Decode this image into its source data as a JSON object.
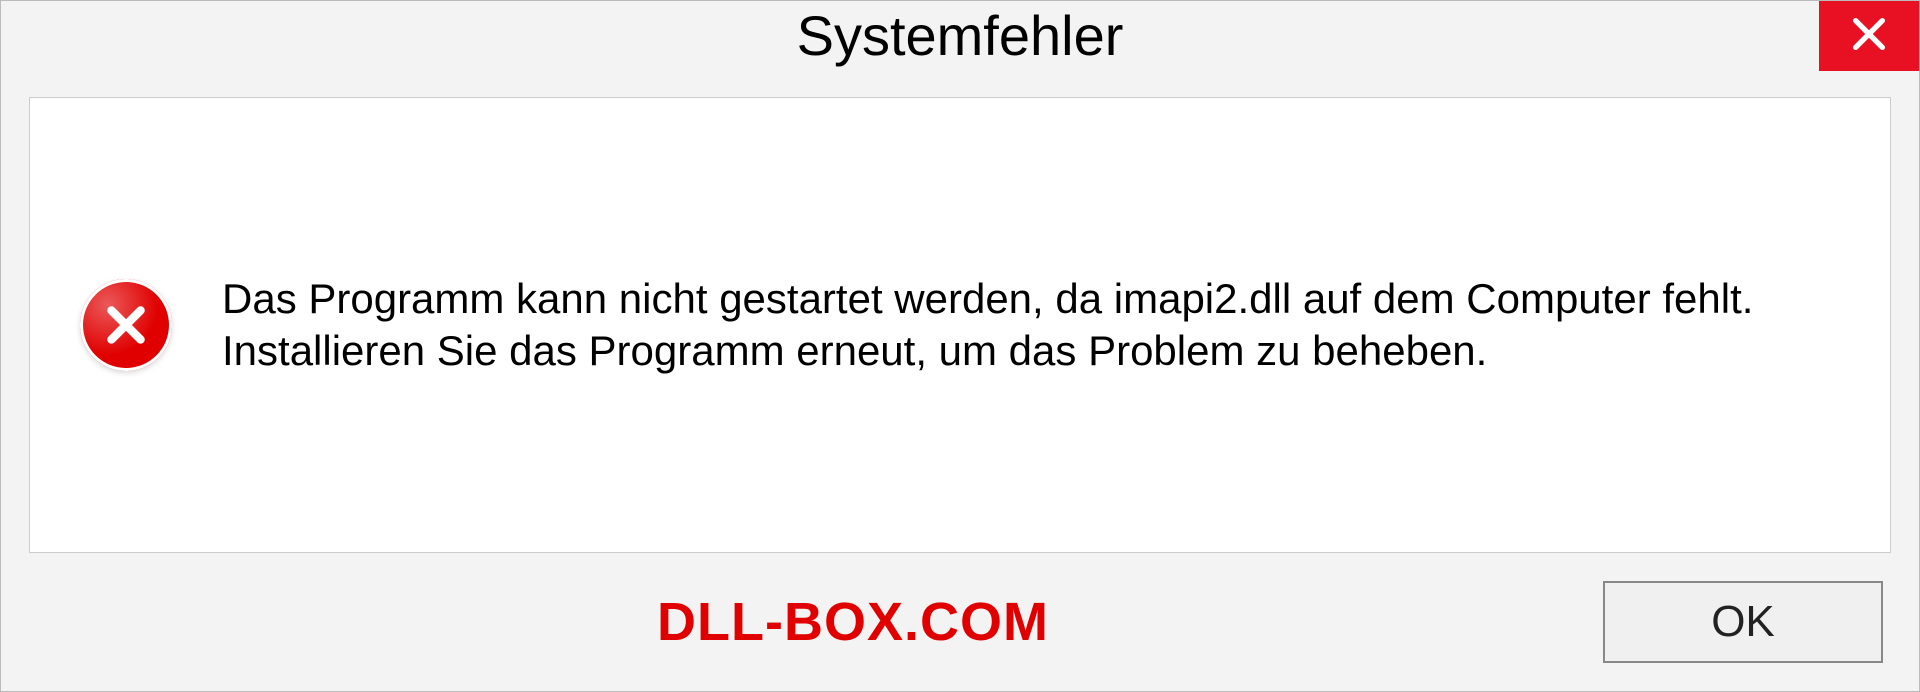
{
  "dialog": {
    "title": "Systemfehler",
    "message": "Das Programm kann nicht gestartet werden, da imapi2.dll auf dem Computer fehlt. Installieren Sie das Programm erneut, um das Problem zu beheben.",
    "ok_label": "OK"
  },
  "watermark": "DLL-BOX.COM",
  "colors": {
    "close_bg": "#e81123",
    "error_red": "#e00000"
  }
}
